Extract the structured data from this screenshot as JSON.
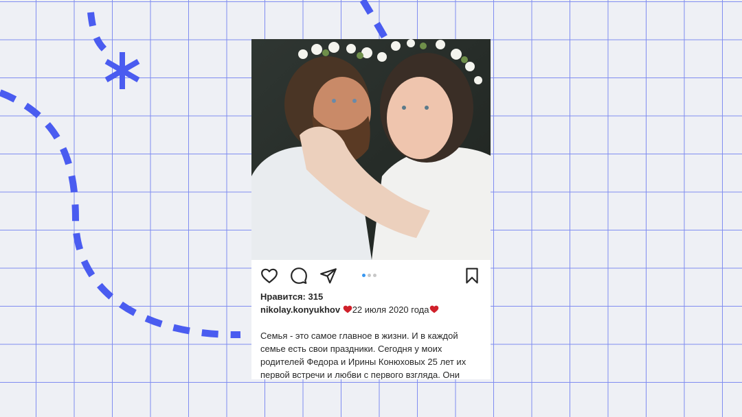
{
  "post": {
    "photo_alt": "photo",
    "likes_text": "Нравится: 315",
    "username": "nikolay.konyukhov",
    "date_text": "22 июля 2020 года",
    "caption_lines": [
      "Семья - это самое главное в жизни. И в каждой",
      "семье есть свои праздники. Сегодня у моих",
      "родителей Федора и Ирины Конюховых 25 лет их",
      "первой встречи и любви с первого взгляда. Они"
    ],
    "carousel": {
      "count": 3,
      "active": 1
    }
  },
  "icons": {
    "like": "heart-outline-icon",
    "comment": "comment-bubble-icon",
    "share": "paper-plane-icon",
    "save": "bookmark-icon",
    "emoji": "red-heart-emoji-icon"
  },
  "colors": {
    "accent": "#4a5cf0",
    "grid": "#7f8cf0",
    "background": "#eef0f5",
    "heart_emoji": "#d0212b",
    "dot_active": "#3897f0"
  }
}
